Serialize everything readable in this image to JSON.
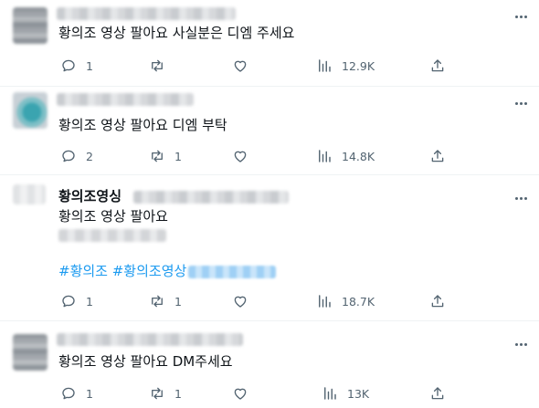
{
  "tweets": [
    {
      "text": "황의조 영상 팔아요 사실분은 디엠 주세요",
      "replies": "1",
      "retweets": "",
      "views": "12.9K"
    },
    {
      "text": "황의조 영상 팔아요 디엠 부탁",
      "replies": "2",
      "retweets": "1",
      "views": "14.8K"
    },
    {
      "author": "황의조영싱",
      "text": "황의조 영상 팔아요",
      "hashtags": "#황의조 #황의조영상",
      "replies": "1",
      "retweets": "1",
      "views": "18.7K"
    },
    {
      "text": "황의조 영상 팔아요 DM주세요",
      "replies": "1",
      "retweets": "1",
      "views": "13K"
    }
  ],
  "icons": {
    "reply": "reply-icon",
    "retweet": "retweet-icon",
    "like": "like-icon",
    "views": "views-icon",
    "share": "share-icon",
    "more": "more-icon"
  },
  "colors": {
    "icon": "#536471",
    "hashtag": "#1d9bf0",
    "divider": "#eff3f4"
  }
}
